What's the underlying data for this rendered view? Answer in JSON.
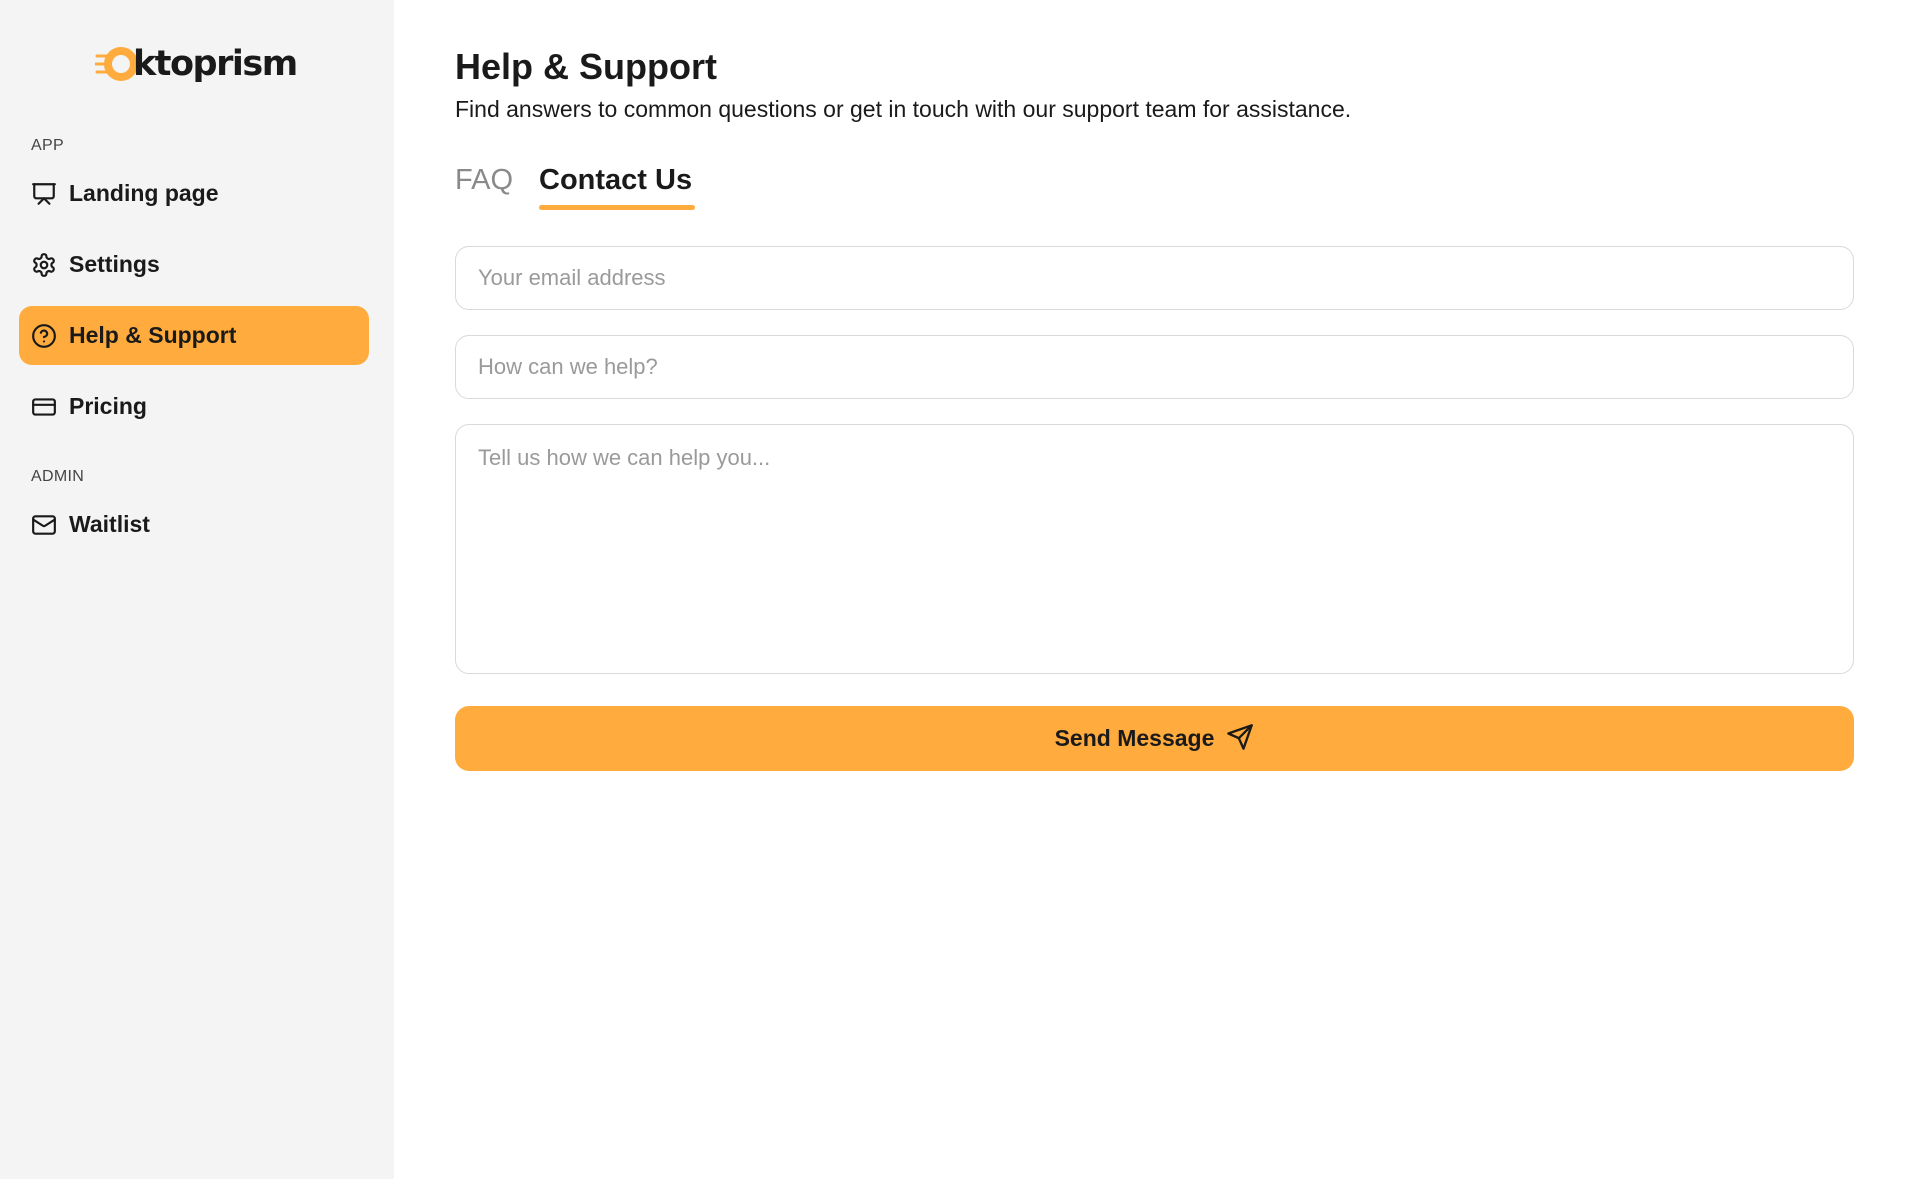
{
  "brand": {
    "name": "Oktoprism",
    "name_rest": "ktoprism",
    "accent_color": "#ffab3d"
  },
  "sidebar": {
    "sections": [
      {
        "label": "APP",
        "items": [
          {
            "label": "Landing page",
            "icon": "presentation-icon",
            "active": false
          },
          {
            "label": "Settings",
            "icon": "gear-icon",
            "active": false
          },
          {
            "label": "Help & Support",
            "icon": "question-circle-icon",
            "active": true
          },
          {
            "label": "Pricing",
            "icon": "credit-card-icon",
            "active": false
          }
        ]
      },
      {
        "label": "ADMIN",
        "items": [
          {
            "label": "Waitlist",
            "icon": "mail-icon",
            "active": false
          }
        ]
      }
    ]
  },
  "main": {
    "title": "Help & Support",
    "subtitle": "Find answers to common questions or get in touch with our support team for assistance.",
    "tabs": [
      {
        "label": "FAQ",
        "active": false
      },
      {
        "label": "Contact Us",
        "active": true
      }
    ],
    "form": {
      "email": {
        "placeholder": "Your email address",
        "value": ""
      },
      "subject": {
        "placeholder": "How can we help?",
        "value": ""
      },
      "message": {
        "placeholder": "Tell us how we can help you...",
        "value": ""
      },
      "submit_label": "Send Message",
      "submit_icon": "send-icon"
    }
  }
}
